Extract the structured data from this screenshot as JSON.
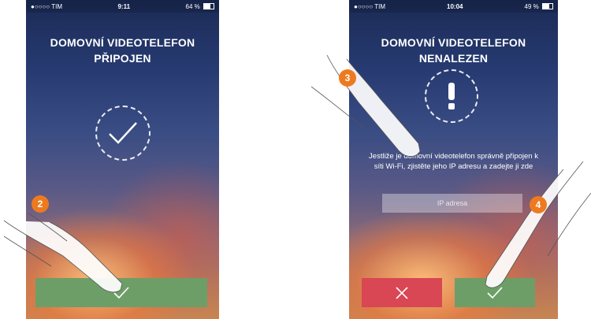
{
  "left_screen": {
    "status": {
      "carrier": "●○○○○ TIM",
      "time": "9:11",
      "battery": "64 %"
    },
    "title_line1": "DOMOVNÍ VIDEOTELEFON",
    "title_line2": "PŘIPOJEN",
    "icon": "checkmark-icon",
    "confirm_button": {
      "icon": "checkmark-icon",
      "color": "#6e9e67"
    }
  },
  "right_screen": {
    "status": {
      "carrier": "●○○○○ TIM",
      "time": "10:04",
      "battery": "49 %"
    },
    "title_line1": "DOMOVNÍ VIDEOTELEFON",
    "title_line2": "NENALEZEN",
    "icon": "exclamation-icon",
    "info_text": "Jestliže je domovní videotelefon správně připojen k síti Wi-Fi, zjistěte jeho IP adresu a zadejte ji zde",
    "ip_input": {
      "placeholder": "IP adresa",
      "value": ""
    },
    "cancel_button": {
      "icon": "close-icon",
      "color": "#d94654"
    },
    "confirm_button": {
      "icon": "checkmark-icon",
      "color": "#6e9e67"
    }
  },
  "steps": [
    {
      "number": "2",
      "color": "#ee7a1f"
    },
    {
      "number": "3",
      "color": "#ee7a1f"
    },
    {
      "number": "4",
      "color": "#ee7a1f"
    }
  ]
}
